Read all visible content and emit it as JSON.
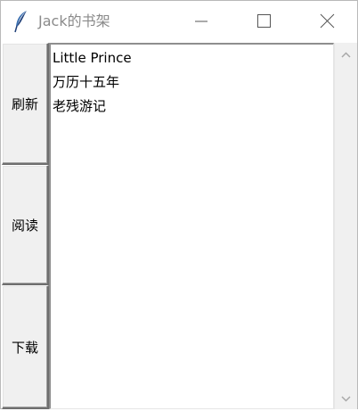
{
  "window": {
    "title": "Jack的书架",
    "icon": "feather-icon",
    "controls": [
      "minimize-icon",
      "maximize-icon",
      "close-icon"
    ]
  },
  "buttons": {
    "refresh_label": "刷新",
    "read_label": "阅读",
    "download_label": "下载"
  },
  "books": [
    "Little Prince",
    "万历十五年",
    "老残游记"
  ],
  "colors": {
    "title_text": "#8a8a8a",
    "button_face": "#f0f0f0",
    "scrollbar": "#f0f0f0",
    "list_background": "#ffffff"
  }
}
